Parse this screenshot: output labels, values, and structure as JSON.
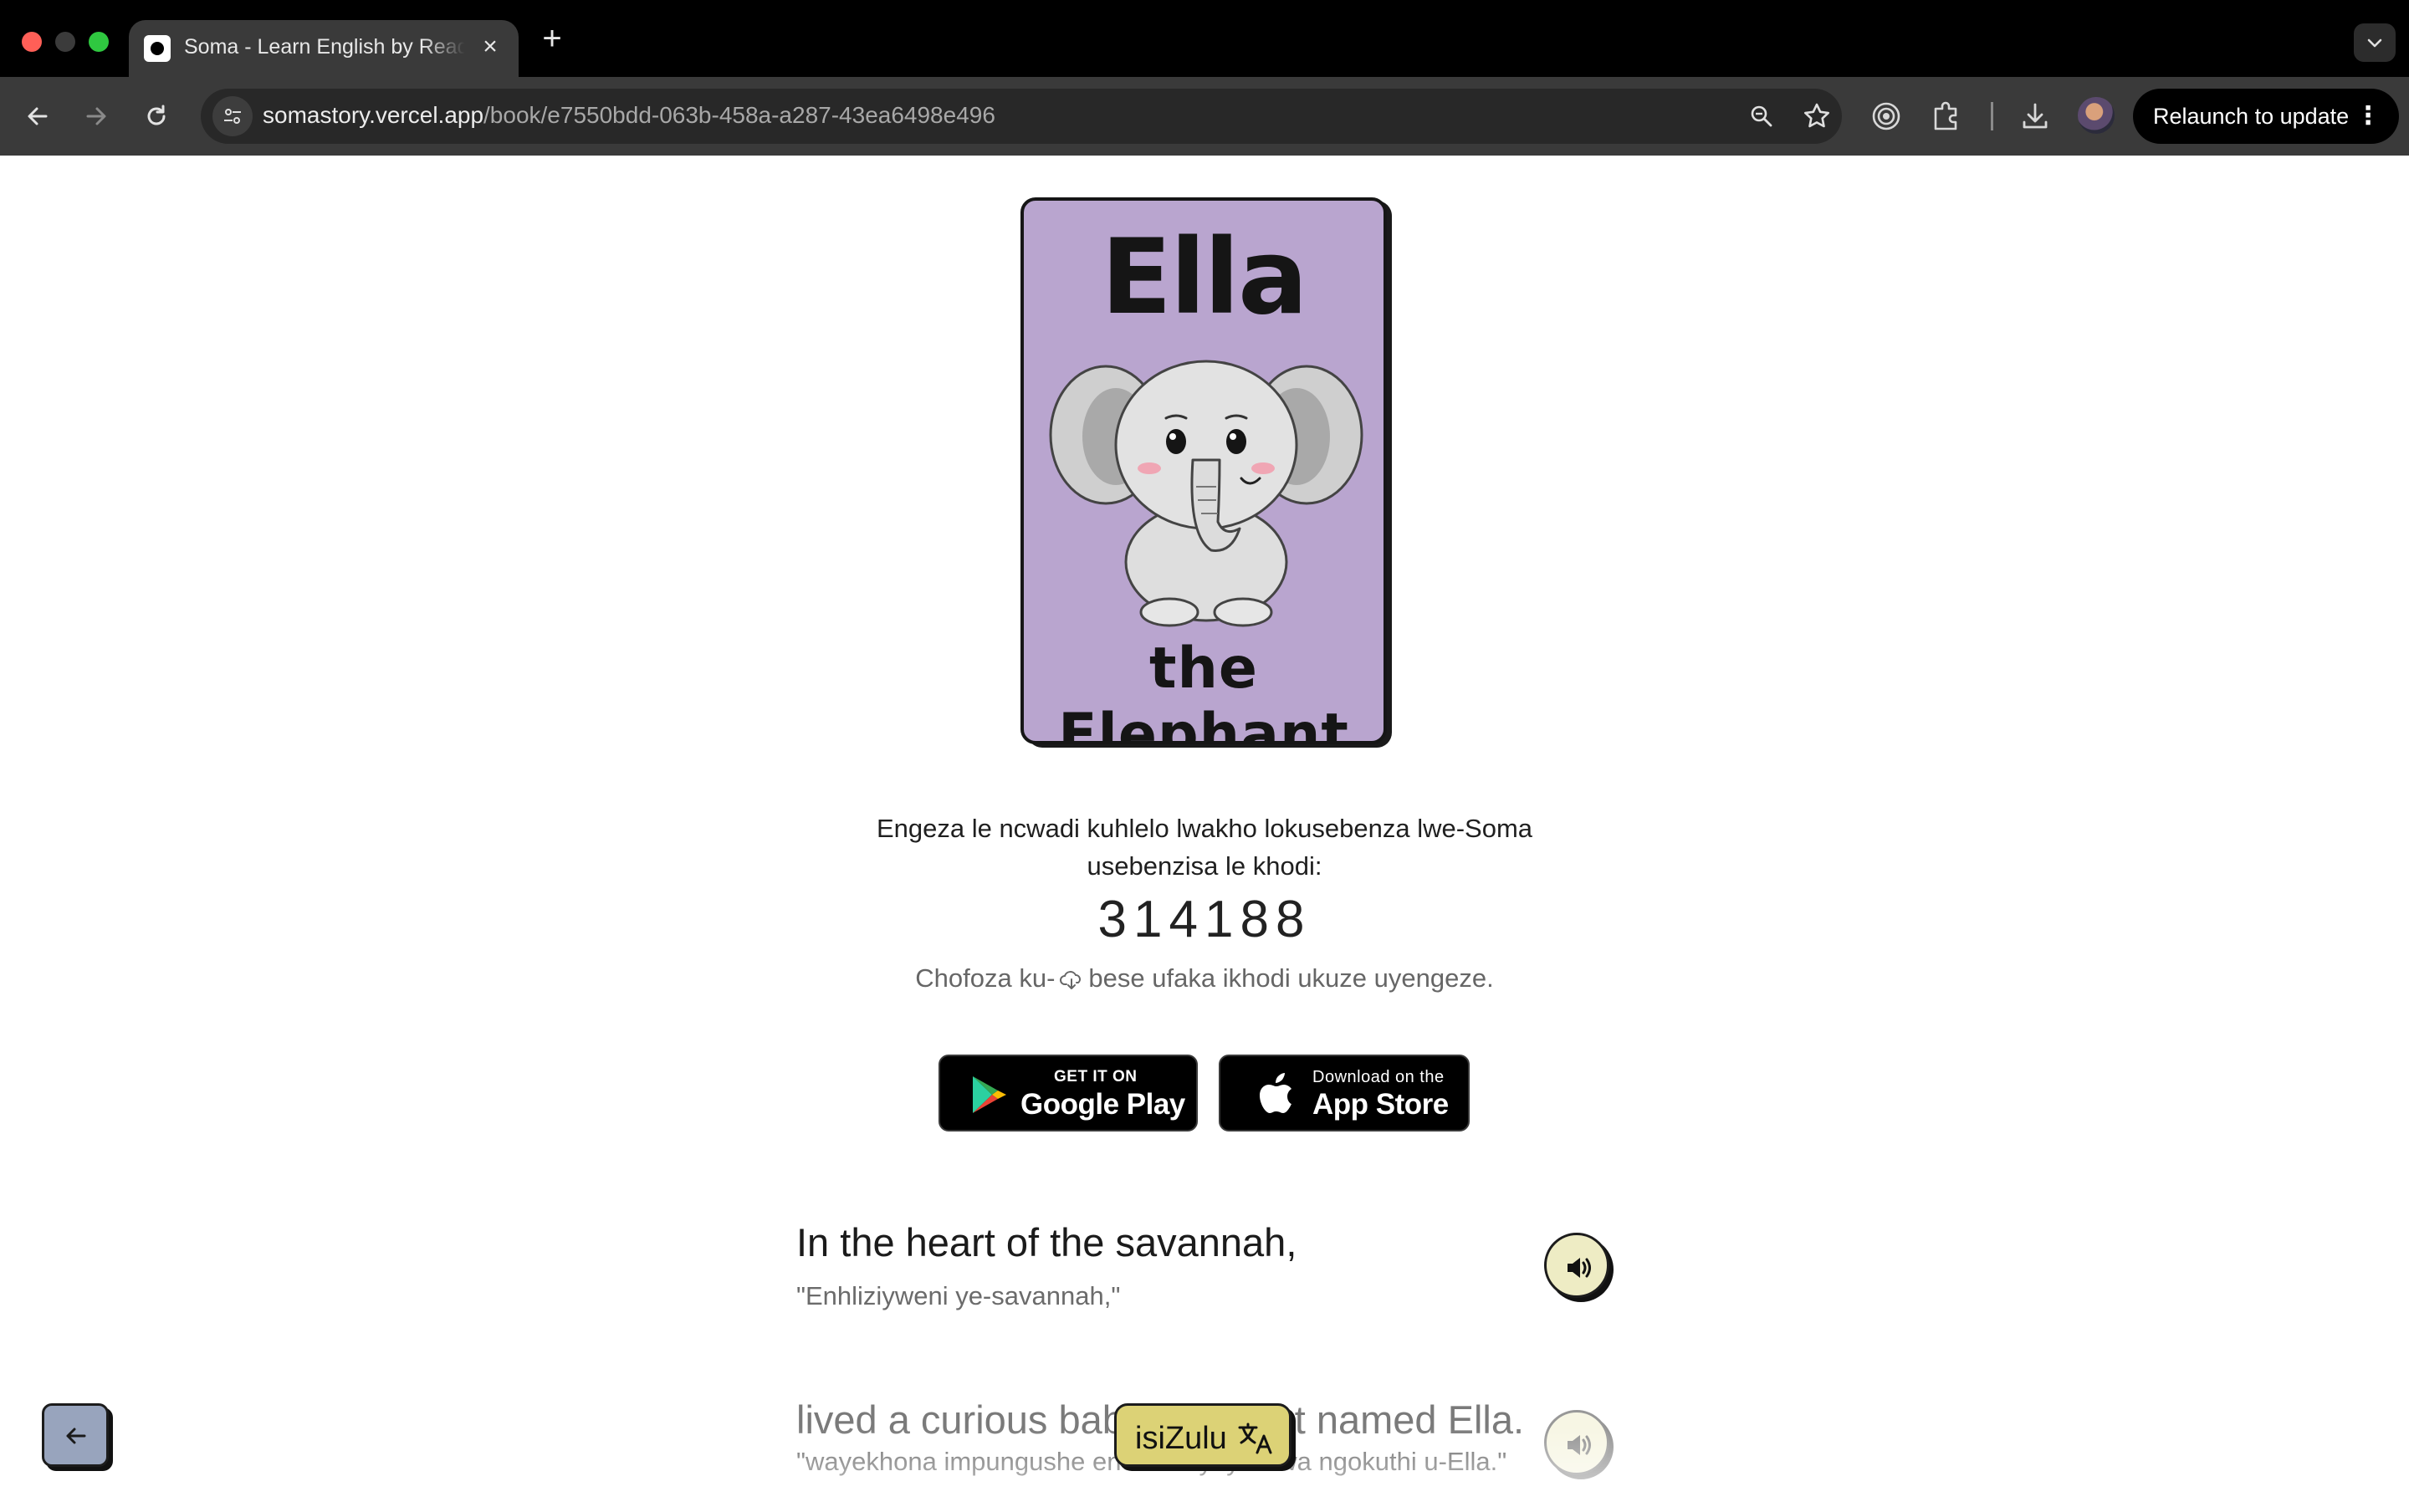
{
  "browser": {
    "tab_title": "Soma - Learn English by Reading",
    "tab_close": "×",
    "new_tab": "+",
    "url_host": "somastory.vercel.app",
    "url_path": "/book/e7550bdd-063b-458a-a287-43ea6498e496",
    "relaunch_label": "Relaunch to update",
    "relaunch_menu": "⋮"
  },
  "book": {
    "cover_title": "Ella",
    "cover_subtitle": "the Elephant",
    "add_instructions": "Engeza le ncwadi kuhlelo lwakho lokusebenza lwe-Soma usebenzisa le khodi:",
    "code": "314188",
    "hint_before": "Chofoza ku-",
    "hint_after": "bese ufaka ikhodi ukuze uyengeze."
  },
  "stores": {
    "google_small": "GET IT ON",
    "google_big": "Google Play",
    "apple_small": "Download on the",
    "apple_big": "App Store"
  },
  "sentences": [
    {
      "english": "In the heart of the savannah,",
      "translation": "\"Enhliziyweni ye-savannah,\""
    },
    {
      "english": "lived a curious baby elephant named Ella.",
      "translation": "\"wayekhona impungushe encane eyayibizwa ngokuthi u-Ella.\""
    }
  ],
  "language_button": "isiZulu",
  "colors": {
    "cover_bg": "#b9a5cf",
    "audio_bg": "#eeecc4",
    "lang_bg": "#dcd276",
    "back_bg": "#98a4bd"
  },
  "icons": {
    "back": "arrow-left-icon",
    "audio": "speaker-icon",
    "translate": "translate-icon",
    "download": "cloud-download-icon"
  }
}
